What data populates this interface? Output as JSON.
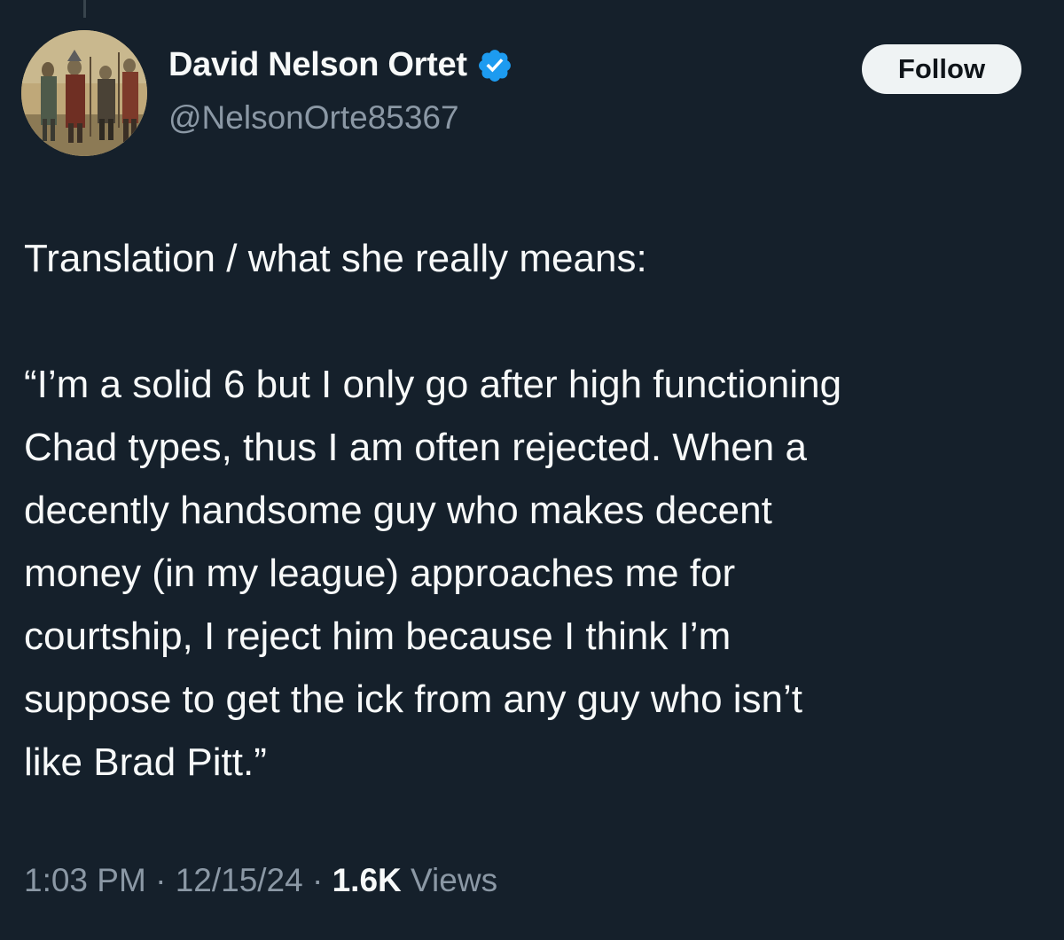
{
  "author": {
    "display_name": "David Nelson Ortet",
    "handle": "@NelsonOrte85367",
    "verified_color": "#1d9bf0",
    "avatar_icon": "medieval-painting-avatar"
  },
  "follow_button": {
    "label": "Follow"
  },
  "tweet": {
    "intro": "Translation / what she really means:",
    "quote": "“I’m a solid 6 but I only go after high functioning\nChad types, thus I am often rejected. When a\ndecently handsome guy who makes decent\nmoney (in my league) approaches me for\ncourtship, I reject him because I think I’m\nsuppose to get the ick from any guy who isn’t\nlike Brad Pitt.”"
  },
  "meta": {
    "time": "1:03 PM",
    "separator": " · ",
    "date": "12/15/24",
    "views_count": "1.6K",
    "views_label": " Views"
  },
  "colors": {
    "background": "#15202b",
    "primary_text": "#f7f9f9",
    "secondary_text": "#8b98a5",
    "button_bg": "#eff3f4"
  }
}
